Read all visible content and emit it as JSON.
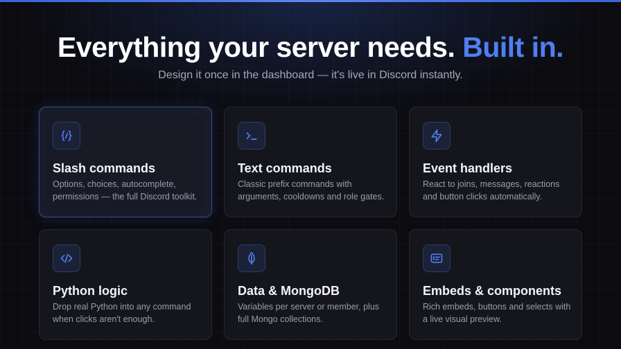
{
  "colors": {
    "accent": "#4f7ff0",
    "background": "#0b0b10",
    "card": "#15161c"
  },
  "header": {
    "title_main": "Everything your server needs.",
    "title_accent": "Built in.",
    "subtitle": "Design it once in the dashboard — it's live in Discord instantly."
  },
  "features": [
    {
      "icon": "braces-slash-icon",
      "title": "Slash commands",
      "description": "Options, choices, autocomplete, permissions — the full Discord toolkit."
    },
    {
      "icon": "terminal-icon",
      "title": "Text commands",
      "description": "Classic prefix commands with arguments, cooldowns and role gates."
    },
    {
      "icon": "lightning-icon",
      "title": "Event handlers",
      "description": "React to joins, messages, reactions and button clicks automatically."
    },
    {
      "icon": "code-icon",
      "title": "Python logic",
      "description": "Drop real Python into any command when clicks aren't enough."
    },
    {
      "icon": "leaf-icon",
      "title": "Data & MongoDB",
      "description": "Variables per server or member, plus full Mongo collections."
    },
    {
      "icon": "embed-icon",
      "title": "Embeds & components",
      "description": "Rich embeds, buttons and selects with a live visual preview."
    }
  ]
}
